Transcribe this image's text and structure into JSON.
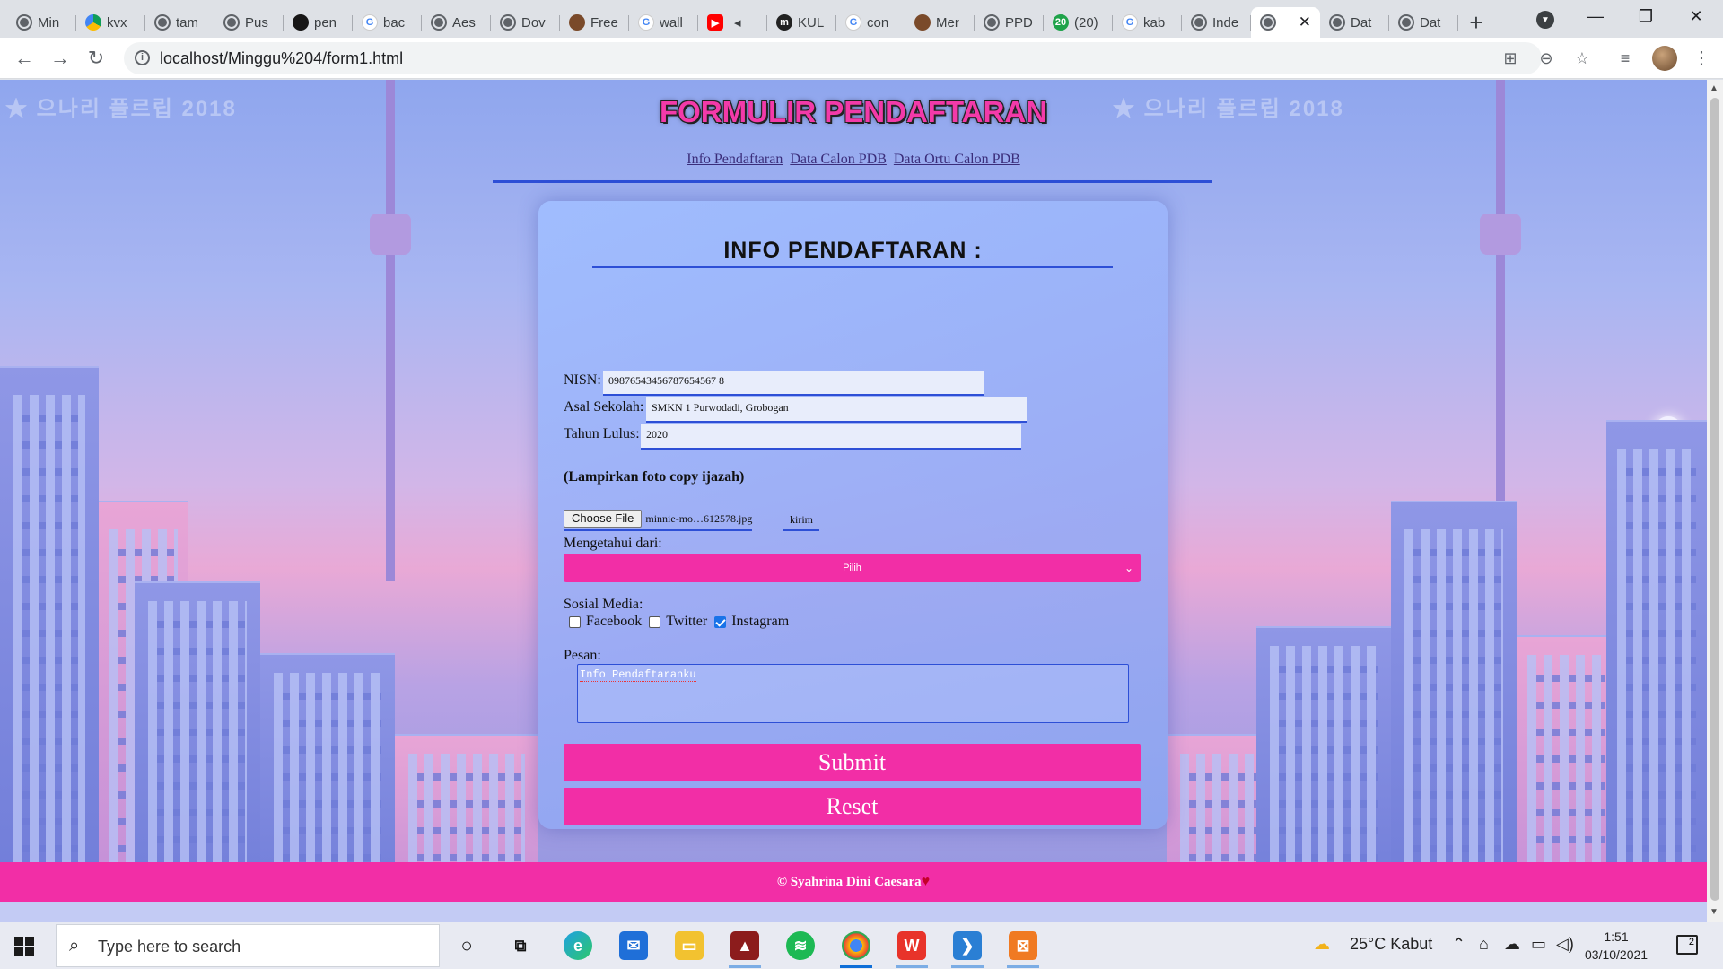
{
  "browser": {
    "tabs": [
      {
        "label": "Min",
        "icon": "globe-icon"
      },
      {
        "label": "kvx",
        "icon": "google-drive-icon"
      },
      {
        "label": "tam",
        "icon": "globe-icon"
      },
      {
        "label": "Pus",
        "icon": "globe-icon"
      },
      {
        "label": "pen",
        "icon": "github-icon"
      },
      {
        "label": "bac",
        "icon": "google-icon"
      },
      {
        "label": "Aes",
        "icon": "globe-icon"
      },
      {
        "label": "Dov",
        "icon": "globe-icon"
      },
      {
        "label": "Free",
        "icon": "app-icon"
      },
      {
        "label": "wall",
        "icon": "google-icon"
      },
      {
        "label": "",
        "icon": "youtube-icon"
      },
      {
        "label": "KUL",
        "icon": "m-icon"
      },
      {
        "label": "con",
        "icon": "google-icon"
      },
      {
        "label": "Mer",
        "icon": "app-icon"
      },
      {
        "label": "PPD",
        "icon": "globe-icon"
      },
      {
        "label": "(20)",
        "icon": "green-20-icon"
      },
      {
        "label": "kab",
        "icon": "google-icon"
      },
      {
        "label": "Inde",
        "icon": "globe-icon"
      },
      {
        "label": "",
        "icon": "globe-icon",
        "active": true
      },
      {
        "label": "Dat",
        "icon": "globe-icon"
      },
      {
        "label": "Dat",
        "icon": "globe-icon"
      }
    ],
    "url": "localhost/Minggu%204/form1.html"
  },
  "page": {
    "title": "FORMULIR PENDAFTARAN",
    "nav": [
      "Info Pendaftaran",
      "Data Calon PDB",
      "Data Ortu Calon PDB"
    ],
    "card_title": "INFO PENDAFTARAN :",
    "nisn_label": "NISN:",
    "nisn_value": "09876543456787654567 8",
    "school_label": "Asal Sekolah:",
    "school_value": "SMKN 1 Purwodadi, Grobogan",
    "year_label": "Tahun Lulus:",
    "year_value": "2020",
    "attach_label": "(Lampirkan foto copy ijazah)",
    "choose_file": "Choose File",
    "file_name": "minnie-mo…612578.jpg",
    "send_label": "kirim",
    "source_label": "Mengetahui dari:",
    "source_selected": "Pilih",
    "social_label": "Sosial Media:",
    "social": [
      {
        "label": "Facebook",
        "checked": false
      },
      {
        "label": "Twitter",
        "checked": false
      },
      {
        "label": "Instagram",
        "checked": true
      }
    ],
    "message_label": "Pesan:",
    "message_value": "Info Pendaftaranku",
    "submit": "Submit",
    "reset": "Reset",
    "footer": "© Syahrina Dini Caesara"
  },
  "taskbar": {
    "search_placeholder": "Type here to search",
    "weather": "25°C  Kabut",
    "time": "1:51",
    "date": "03/10/2021",
    "notifications": "2"
  },
  "colors": {
    "accent": "#f22ea6",
    "rule": "#2d4fd6"
  }
}
